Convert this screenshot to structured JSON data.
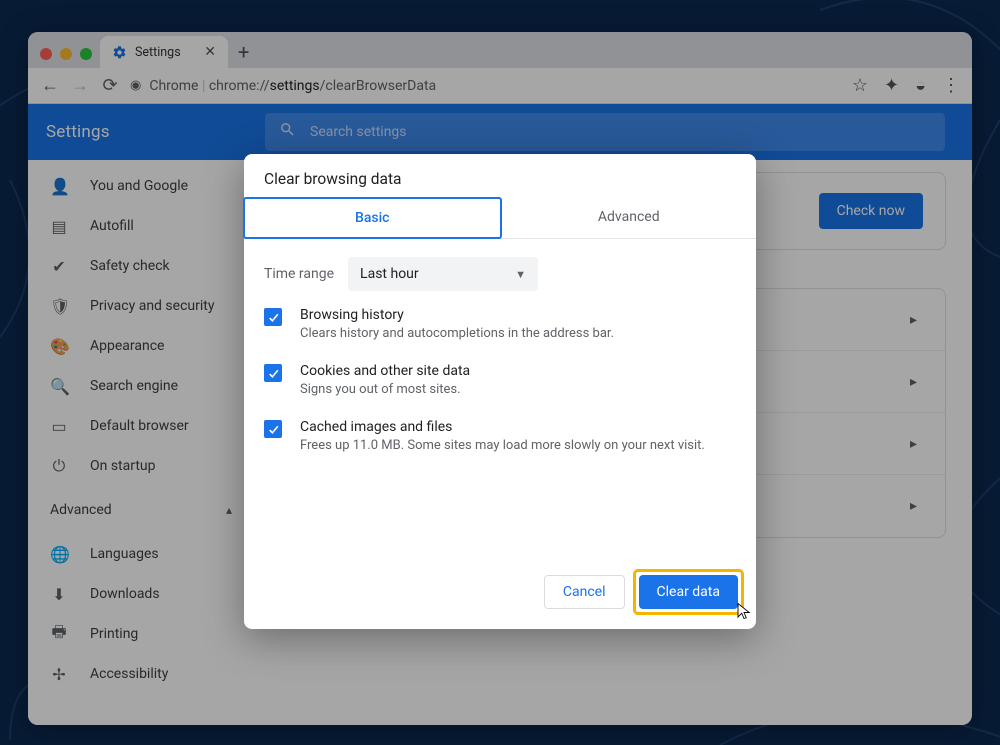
{
  "browserTab": {
    "title": "Settings"
  },
  "omnibox": {
    "scheme": "Chrome",
    "url_pre": "chrome://",
    "url_bold": "settings",
    "url_post": "/clearBrowserData"
  },
  "header": {
    "title": "Settings",
    "searchPlaceholder": "Search settings"
  },
  "sidebar": {
    "items": [
      {
        "icon": "person",
        "label": "You and Google"
      },
      {
        "icon": "autofill",
        "label": "Autofill"
      },
      {
        "icon": "shield",
        "label": "Safety check"
      },
      {
        "icon": "privacy",
        "label": "Privacy and security"
      },
      {
        "icon": "palette",
        "label": "Appearance"
      },
      {
        "icon": "search",
        "label": "Search engine"
      },
      {
        "icon": "browser",
        "label": "Default browser"
      },
      {
        "icon": "power",
        "label": "On startup"
      }
    ],
    "advanced": "Advanced",
    "advanced_items": [
      {
        "icon": "globe",
        "label": "Languages"
      },
      {
        "icon": "download",
        "label": "Downloads"
      },
      {
        "icon": "print",
        "label": "Printing"
      },
      {
        "icon": "a11y",
        "label": "Accessibility"
      }
    ]
  },
  "safety": {
    "checkNow": "Check now"
  },
  "modal": {
    "title": "Clear browsing data",
    "tabs": {
      "basic": "Basic",
      "advanced": "Advanced"
    },
    "timeRange": {
      "label": "Time range",
      "value": "Last hour"
    },
    "options": [
      {
        "title": "Browsing history",
        "desc": "Clears history and autocompletions in the address bar.",
        "checked": true
      },
      {
        "title": "Cookies and other site data",
        "desc": "Signs you out of most sites.",
        "checked": true
      },
      {
        "title": "Cached images and files",
        "desc": "Frees up 11.0 MB. Some sites may load more slowly on your next visit.",
        "checked": true
      }
    ],
    "cancel": "Cancel",
    "clear": "Clear data"
  }
}
